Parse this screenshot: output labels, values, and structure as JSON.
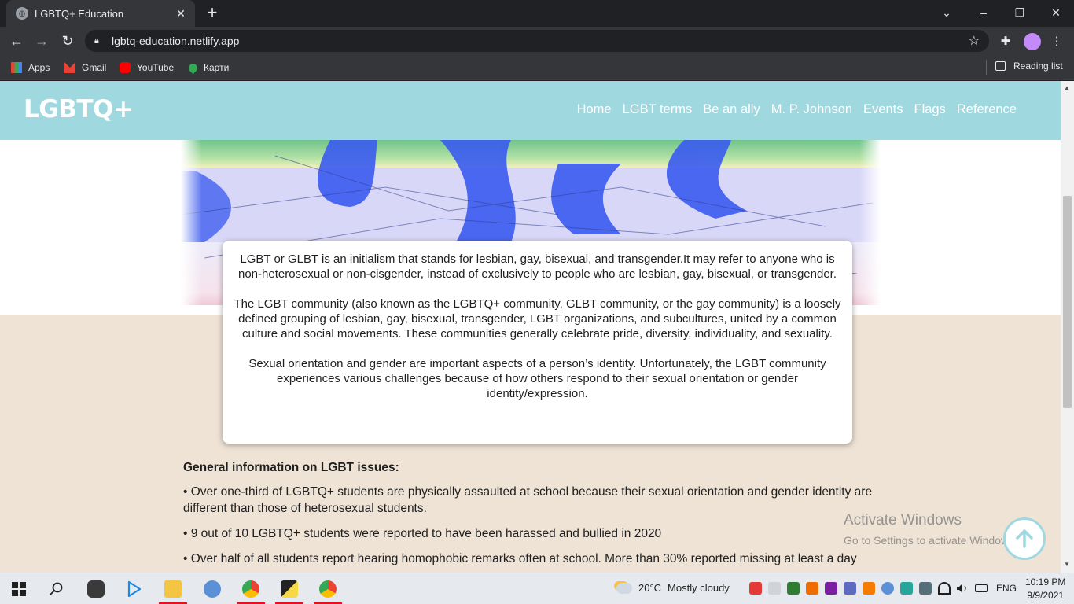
{
  "browser": {
    "tab_title": "LGBTQ+ Education",
    "tab_close": "✕",
    "new_tab": "+",
    "url": "lgbtq-education.netlify.app",
    "window_controls": {
      "chevron": "⌄",
      "minimize": "–",
      "restore": "❐",
      "close": "✕"
    },
    "bookmarks": [
      {
        "label": "Apps",
        "icon": "apps-grid-icon"
      },
      {
        "label": "Gmail",
        "icon": "gmail-icon"
      },
      {
        "label": "YouTube",
        "icon": "youtube-icon"
      },
      {
        "label": "Карти",
        "icon": "maps-pin-icon"
      }
    ],
    "reading_list": "Reading list"
  },
  "site": {
    "logo": "LGBTQ+",
    "nav": [
      "Home",
      "LGBT terms",
      "Be an ally",
      "M. P. Johnson",
      "Events",
      "Flags",
      "Reference"
    ],
    "header_color": "#a0d8e0",
    "page_background": "#efe3d6",
    "intro_paragraphs": [
      "LGBT or GLBT is an initialism that stands for lesbian, gay, bisexual, and transgender.It may refer to anyone who is non-heterosexual or non-cisgender, instead of exclusively to people who are lesbian, gay, bisexual, or transgender.",
      "The LGBT community (also known as the LGBTQ+ community, GLBT community, or the gay community) is a loosely defined grouping of lesbian, gay, bisexual, transgender, LGBT organizations, and subcultures, united by a common culture and social movements. These communities generally celebrate pride, diversity, individuality, and sexuality.",
      "Sexual orientation and gender are important aspects of a person’s identity. Unfortunately, the LGBT community experiences various challenges because of how others respond to their sexual orientation or gender identity/expression."
    ],
    "general_heading": "General information on LGBT issues:",
    "facts": [
      "•  Over one-third of LGBTQ+ students are physically assaulted at school because their sexual orientation and gender identity are different than those of heterosexual students.",
      "•  9 out of 10 LGBTQ+ students were reported to have been harassed and bullied in 2020",
      "•  Over half of all students report hearing homophobic remarks often at school. More than 30% reported missing at least a day"
    ]
  },
  "watermark": {
    "line1": "Activate Windows",
    "line2": "Go to Settings to activate Windows."
  },
  "taskbar": {
    "weather_temp": "20°C",
    "weather_desc": "Mostly cloudy",
    "language": "ENG",
    "time": "10:19 PM",
    "date": "9/9/2021"
  }
}
